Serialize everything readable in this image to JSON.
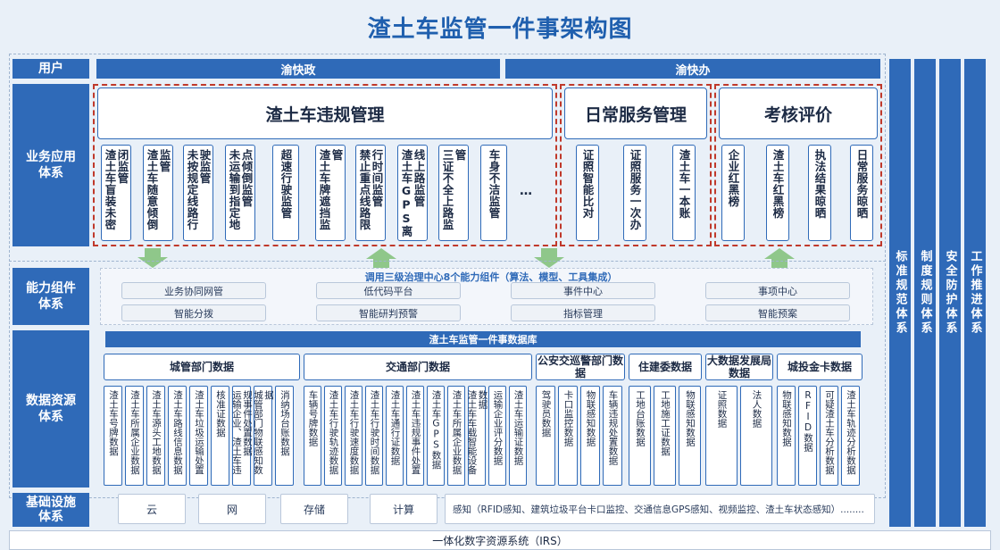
{
  "title": "渣土车监管一件事架构图",
  "layers": {
    "user": "用户",
    "app": "业务应用\n体系",
    "capability": "能力组件\n体系",
    "data": "数据资源\n体系",
    "infra": "基础设施\n体系"
  },
  "user_bar": {
    "left": "渝快政",
    "right": "渝快办"
  },
  "app": {
    "groups": [
      {
        "title": "渣土车违规管理",
        "items": [
          "渣土车盲装未密闭监管",
          "渣土车随意倾倒监管",
          "未按规定线路行驶监管",
          "未运输到指定地点倾倒监管",
          "超速行驶监管",
          "渣土车牌遮挡监管",
          "禁止重点线路限行时间监管",
          "渣土车GPS离线上路监管",
          "三证不全上路监管",
          "车身不洁监管",
          "…"
        ]
      },
      {
        "title": "日常服务管理",
        "items": [
          "证照智能比对",
          "证照服务一次办",
          "渣土车一本账"
        ]
      },
      {
        "title": "考核评价",
        "items": [
          "企业红黑榜",
          "渣土车红黑榜",
          "执法结果晾晒",
          "日常服务晾晒"
        ]
      }
    ]
  },
  "capability": {
    "banner": "调用三级治理中心8个能力组件（算法、模型、工具集成）",
    "items": [
      "业务协同网管",
      "低代码平台",
      "事件中心",
      "事项中心",
      "智能分拨",
      "智能研判预警",
      "指标管理",
      "智能预案"
    ]
  },
  "data": {
    "banner": "渣土车监管一件事数据库",
    "groups": [
      {
        "title": "城管部门数据",
        "items": [
          "渣土车号牌数据",
          "渣土车所属企业数据",
          "渣土车源头工地数据",
          "渣土车路线信息数据",
          "渣土车垃圾运输处置",
          "核准证数据",
          "运输企业、渣土车违规事件处置数据",
          "城管部门物联感知数据",
          "消纳场台账数据"
        ]
      },
      {
        "title": "交通部门数据",
        "items": [
          "车辆号牌数据",
          "渣土车行驶轨迹数据",
          "渣土车行驶速度数据",
          "渣土车行驶时间数据",
          "渣土车通行证数据",
          "渣土车违规事件处置",
          "渣土车GPS数据",
          "渣土车所属企业数据",
          "渣土车车载智能设备数据",
          "运输企业评分数据",
          "渣土车运输证数据"
        ]
      },
      {
        "title": "公安交巡警部门数据",
        "items": [
          "驾驶员数据",
          "卡口监控数据",
          "物联感知数据",
          "车辆违规处置数据"
        ]
      },
      {
        "title": "住建委数据",
        "items": [
          "工地台账数据",
          "工地施工证数据",
          "物联感知数据"
        ]
      },
      {
        "title": "大数据发展局数据",
        "items": [
          "证照数据",
          "法人数据"
        ]
      },
      {
        "title": "城投金卡数据",
        "items": [
          "物联感知数据",
          "RFID数据",
          "可疑渣土车分析数据",
          "渣土车轨迹分析数据"
        ]
      }
    ]
  },
  "infra": {
    "items": [
      "云",
      "网",
      "存储",
      "计算"
    ],
    "sensing": "感知（RFID感知、建筑垃圾平台卡口监控、交通信息GPS感知、视频监控、渣土车状态感知）........"
  },
  "footer": "一体化数字资源系统（IRS）",
  "right_columns": [
    "标准规范体系",
    "制度规则体系",
    "安全防护体系",
    "工作推进体系"
  ],
  "colors": {
    "primary": "#2f6ab8",
    "title": "#1f5fae",
    "red_dash": "#c0392b",
    "arrow": "#8fc78a"
  }
}
